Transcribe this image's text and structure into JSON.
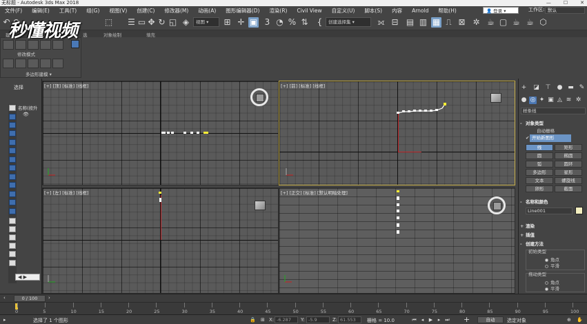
{
  "window": {
    "title": "无标题 - Autodesk 3ds Max 2018",
    "controls": [
      "—",
      "☐",
      "✕"
    ]
  },
  "menu": {
    "items": [
      "文件(F)",
      "编辑(E)",
      "工具(T)",
      "组(G)",
      "视图(V)",
      "创建(C)",
      "修改器(M)",
      "动画(A)",
      "图形编辑器(D)",
      "渲染(R)",
      "Civil View",
      "自定义(U)",
      "脚本(S)",
      "内容",
      "Arnold",
      "帮助(H)"
    ],
    "signin": "登录",
    "workspace_label": "工作区:",
    "workspace_value": "默认"
  },
  "toolbar": {
    "view_dropdown": "视图",
    "selection_set": "创建选择集",
    "snap_label": "3",
    "angle_snap": "%"
  },
  "watermark": {
    "text": "秒懂视频"
  },
  "ribbon": {
    "tab1": "建",
    "tab2": "选",
    "tab3": "对象绘制",
    "tab4": "填充",
    "mode_label": "修改模式",
    "poly_label": "多边形建模 ▾"
  },
  "explorer": {
    "title": "选择",
    "name_column": "名称(按升",
    "scroll_arrows": "◀ ▶"
  },
  "viewports": {
    "top": "[+] [顶] [标准] [线框]",
    "front": "[+] [前] [标准] [线框]",
    "left": "[+] [左] [标准] [线框]",
    "persp": "[+] [正交] [标准] [默认明暗处理]"
  },
  "command_panel": {
    "dropdown": "样条线",
    "object_type": "对象类型",
    "autogrid": "自动栅格",
    "start_new_shape": "开始新图形",
    "buttons": [
      [
        "线",
        "矩形"
      ],
      [
        "圆",
        "椭圆"
      ],
      [
        "弧",
        "圆环"
      ],
      [
        "多边形",
        "星形"
      ],
      [
        "文本",
        "螺旋线"
      ],
      [
        "卵形",
        "截面"
      ]
    ],
    "name_and_color": "名称和颜色",
    "object_name": "Line001",
    "rendering": "渲染",
    "interpolation": "插值",
    "creation_method": "创建方法",
    "initial_type": "初始类型",
    "corner": "角点",
    "smooth": "平滑",
    "drag_type": "拖动类型",
    "corner2": "角点",
    "smooth2": "平滑"
  },
  "timeline": {
    "frame": "0 / 100",
    "ticks": [
      "0",
      "5",
      "10",
      "15",
      "20",
      "25",
      "30",
      "35",
      "40",
      "45",
      "50",
      "55",
      "60",
      "65",
      "70",
      "75",
      "80",
      "85",
      "90",
      "95",
      "100"
    ]
  },
  "status": {
    "selected": "选择了 1 个图形",
    "x_label": "X:",
    "x_value": "-6.287",
    "y_label": "Y:",
    "y_value": "-5.9",
    "z_label": "Z:",
    "z_value": "61.553",
    "grid": "栅格 = 10.0",
    "autokey": "自动",
    "selected_obj": "选定对象"
  },
  "colors": {
    "accent": "#6b94c5",
    "active_viewport_border": "#c8b04a",
    "spline": "#ffffff",
    "vertex_selected": "#ffee33"
  }
}
